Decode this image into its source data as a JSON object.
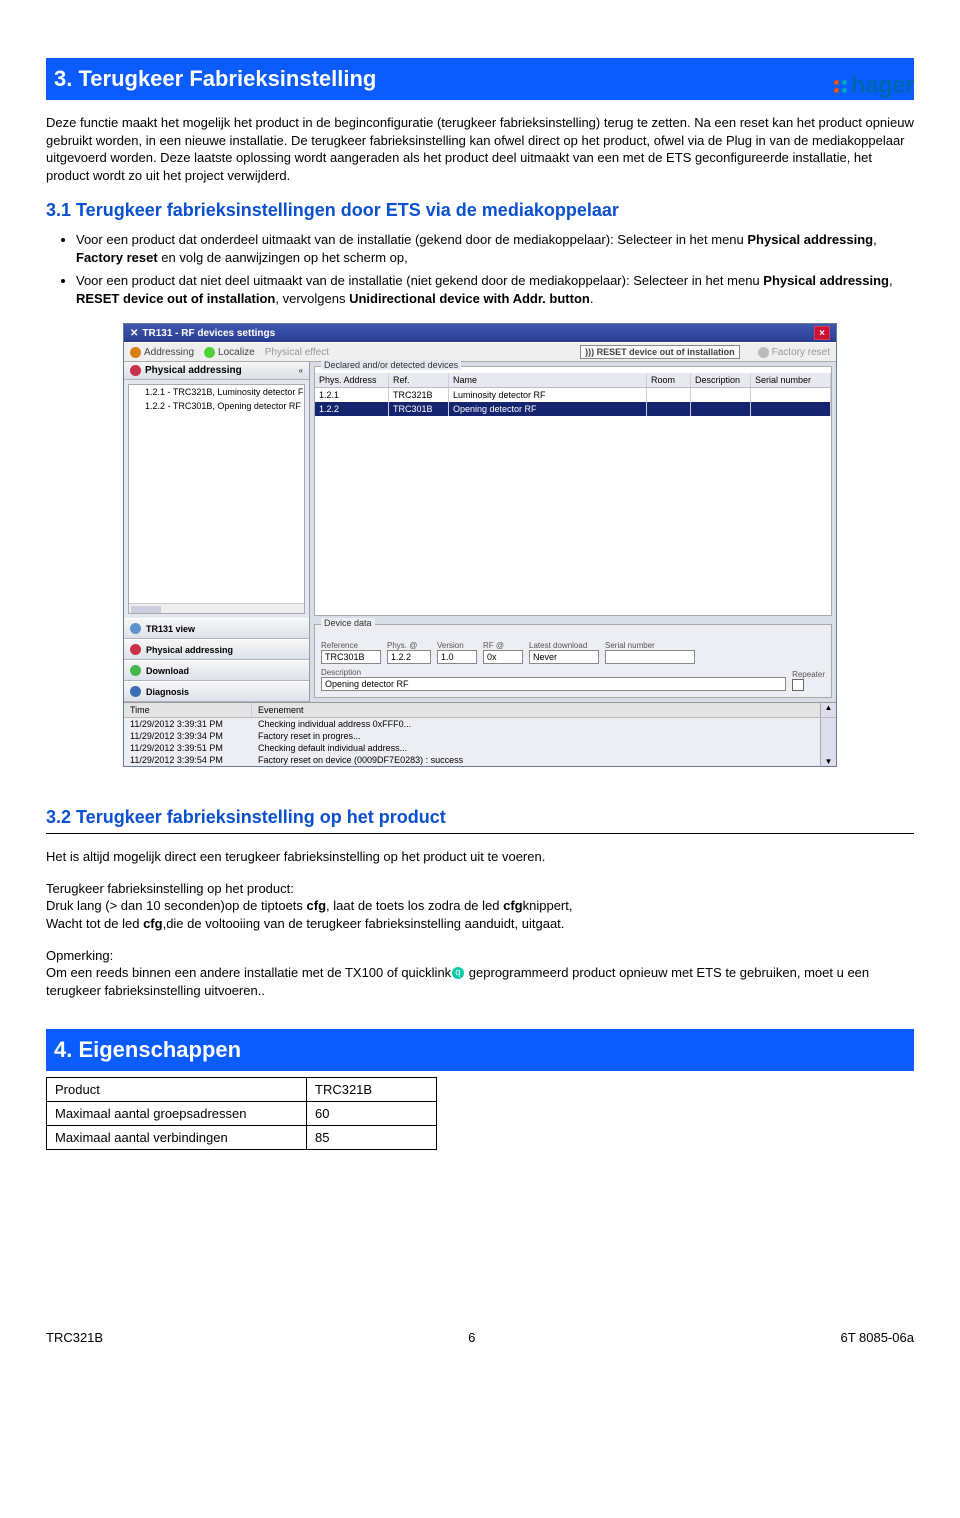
{
  "brand": "hager",
  "section3": {
    "title": "3. Terugkeer Fabrieksinstelling",
    "para": "Deze functie maakt het mogelijk het product in de beginconfiguratie (terugkeer fabrieksinstelling) terug te zetten. Na een reset kan het product opnieuw gebruikt worden, in een nieuwe installatie. De terugkeer fabrieksinstelling kan ofwel direct op het product, ofwel via de Plug in van de mediakoppelaar uitgevoerd worden. Deze laatste oplossing wordt aangeraden als het product deel uitmaakt van een met de  ETS geconfigureerde installatie, het product wordt zo uit het project verwijderd."
  },
  "section31": {
    "title": "3.1 Terugkeer fabrieksinstellingen door ETS via de mediakoppelaar",
    "bullet1a": "Voor een product dat onderdeel uitmaakt van de installatie (gekend door de mediakoppelaar): Selecteer in het menu ",
    "bullet1b": "Physical addressing",
    "bullet1c": ", ",
    "bullet1d": "Factory reset",
    "bullet1e": " en volg de aanwijzingen op het scherm op,",
    "bullet2a": "Voor een product dat niet deel uitmaakt van de installatie (niet gekend door de mediakoppelaar): Selecteer in het menu ",
    "bullet2b": "Physical addressing",
    "bullet2c": ", ",
    "bullet2d": "RESET device out of installation",
    "bullet2e": ", vervolgens ",
    "bullet2f": "Unidirectional device with Addr. button",
    "bullet2g": "."
  },
  "win": {
    "title": "TR131 - RF devices settings",
    "menu_addressing": "Addressing",
    "menu_localize": "Localize",
    "menu_physeff": "Physical effect",
    "reset_btn": "))) RESET device out of installation",
    "factory_reset": "Factory reset",
    "pa_panel": "Physical addressing",
    "tree_items": [
      "1.2.1 - TRC321B, Luminosity detector F",
      "1.2.2 - TRC301B, Opening detector RF"
    ],
    "nav": [
      "TR131 view",
      "Physical addressing",
      "Download",
      "Diagnosis"
    ],
    "group_label": "Declared and/or detected devices",
    "headers": {
      "addr": "Phys. Address",
      "ref": "Ref.",
      "name": "Name",
      "room": "Room",
      "desc": "Description",
      "sn": "Serial number"
    },
    "rows": [
      {
        "addr": "1.2.1",
        "ref": "TRC321B",
        "name": "Luminosity detector RF"
      },
      {
        "addr": "1.2.2",
        "ref": "TRC301B",
        "name": "Opening detector RF"
      }
    ],
    "dd_label": "Device data",
    "dd": {
      "reference": "TRC301B",
      "phys": "1.2.2",
      "version": "1.0",
      "rf": "0x",
      "latest": "Never",
      "serial": ""
    },
    "dd_labels": {
      "ref": "Reference",
      "phys": "Phys. @",
      "ver": "Version",
      "rf": "RF @",
      "latest": "Latest download",
      "serial": "Serial number",
      "desc": "Description",
      "rep": "Repeater"
    },
    "dd_desc": "Opening detector RF",
    "log_head": {
      "time": "Time",
      "ev": "Evenement"
    },
    "log": [
      {
        "t": "11/29/2012 3:39:31 PM",
        "e": "Checking individual address 0xFFF0..."
      },
      {
        "t": "11/29/2012 3:39:34 PM",
        "e": "Factory reset in progres..."
      },
      {
        "t": "11/29/2012 3:39:51 PM",
        "e": "Checking default individual address..."
      },
      {
        "t": "11/29/2012 3:39:54 PM",
        "e": "Factory reset on device (0009DF7E0283) : success"
      }
    ]
  },
  "section32": {
    "title": "3.2 Terugkeer fabrieksinstelling op het product",
    "p1": "Het is altijd mogelijk direct een terugkeer fabrieksinstelling op het product uit te voeren.",
    "p2": "Terugkeer fabrieksinstelling op het product:",
    "p3a": "Druk lang (> dan 10 seconden)op de tiptoets ",
    "p3b": "cfg",
    "p3c": ", laat de toets los zodra de led ",
    "p3d": "cfg",
    "p3e": "knippert,",
    "p4a": "Wacht tot de led ",
    "p4b": "cfg",
    "p4c": ",die de voltooiing van de terugkeer fabrieksinstelling aanduidt, uitgaat.",
    "p5": "Opmerking:",
    "p6a": "Om een reeds binnen een andere installatie met de TX100 of quicklink",
    "p6b": " geprogrammeerd product opnieuw met ETS te gebruiken, moet u een terugkeer fabrieksinstelling uitvoeren.."
  },
  "section4": {
    "title": "4. Eigenschappen"
  },
  "props": {
    "r1k": "Product",
    "r1v": "TRC321B",
    "r2k": "Maximaal aantal groepsadressen",
    "r2v": "60",
    "r3k": "Maximaal aantal verbindingen",
    "r3v": "85"
  },
  "footer": {
    "left": "TRC321B",
    "mid": "6",
    "right": "6T 8085-06a"
  }
}
